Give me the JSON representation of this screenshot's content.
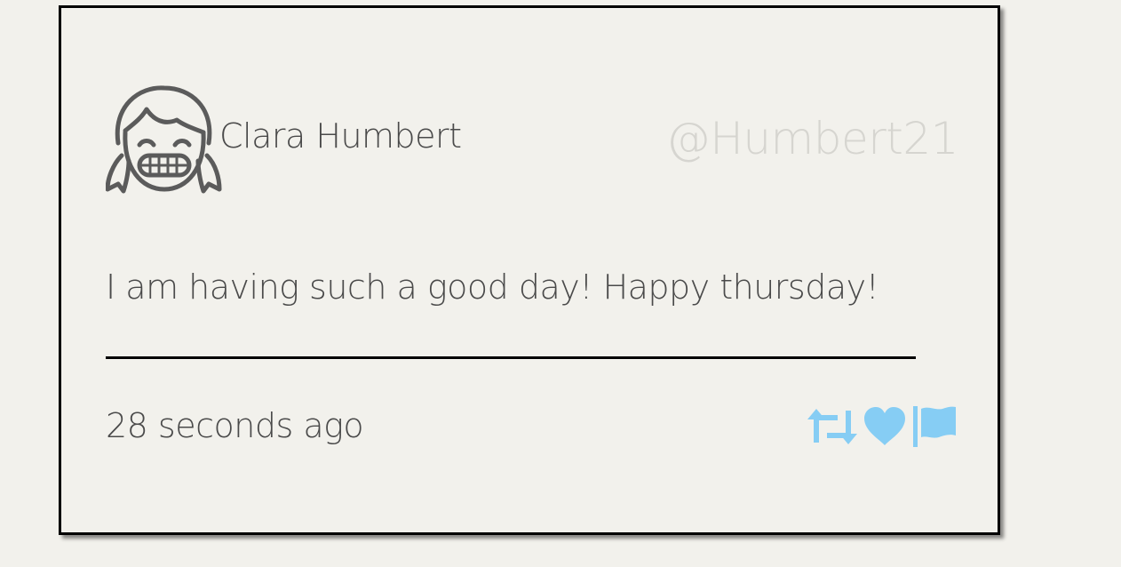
{
  "tweet": {
    "author_name": "Clara Humbert",
    "handle": "@Humbert21",
    "text": "I am having such a good day! Happy thursday!",
    "timestamp": "28 seconds ago"
  },
  "icons": {
    "avatar": "girl-avatar-icon",
    "retweet": "retweet-icon",
    "like": "heart-icon",
    "report": "flag-icon"
  },
  "colors": {
    "background": "#f2f1ec",
    "text": "#4a4a4a",
    "handle": "#d6d5d0",
    "action_icons": "#86cdf4"
  }
}
